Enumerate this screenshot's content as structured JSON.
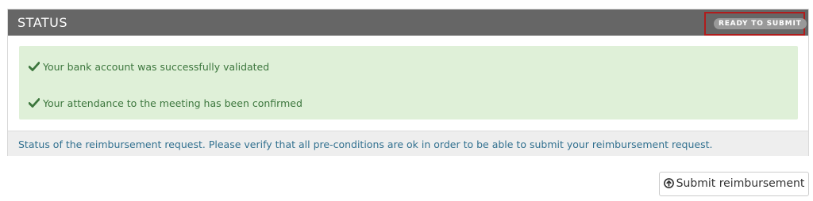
{
  "status_panel": {
    "title": "STATUS",
    "badge": "READY TO SUBMIT",
    "messages": [
      {
        "icon": "check-icon",
        "text": "Your bank account was successfully validated"
      },
      {
        "icon": "check-icon",
        "text": "Your attendance to the meeting has been confirmed"
      }
    ],
    "footer": "Status of the reimbursement request. Please verify that all pre-conditions are ok in order to be able to submit your reimbursement request."
  },
  "actions": {
    "submit_label": "Submit reimbursement",
    "submit_icon": "upload-circle-icon"
  },
  "colors": {
    "header_bg": "#666666",
    "success_bg": "#dff0d8",
    "success_text": "#3c763d",
    "info_text": "#31708f",
    "highlight_border": "#b01c1c"
  }
}
